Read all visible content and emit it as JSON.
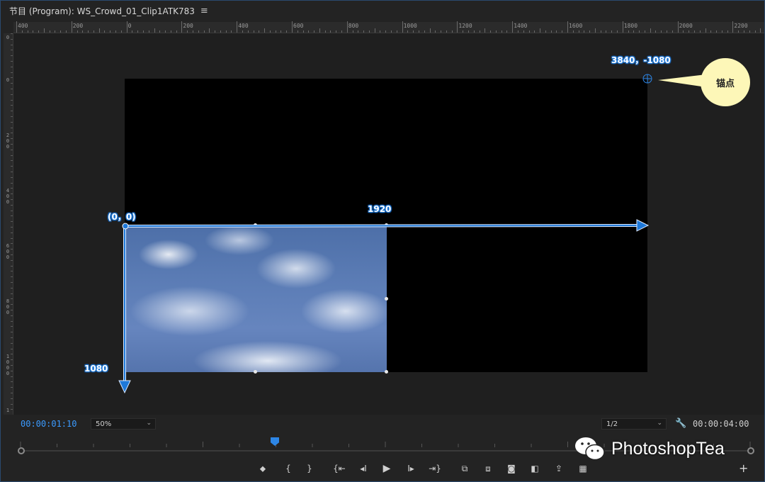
{
  "window": {
    "title": "节目 (Program): WS_Crowd_01_Clip1ATK783",
    "menu_icon": "hamburger-icon"
  },
  "ruler_h": [
    "400",
    "200",
    "0",
    "200",
    "400",
    "600",
    "800",
    "1000",
    "1200",
    "1400",
    "1600",
    "1800",
    "2000",
    "2200"
  ],
  "ruler_v": [
    "0",
    "0",
    "2\n0\n0",
    "4\n0\n0",
    "6\n0\n0",
    "8\n0\n0",
    "1\n0\n0\n0",
    "1"
  ],
  "annotations": {
    "origin": "(0，0)",
    "width_label": "1920",
    "height_label": "1080",
    "anchor_coords": "3840，-1080",
    "anchor_callout": "锚点"
  },
  "bottom_bar": {
    "current_time": "00:00:01:10",
    "zoom": "50%",
    "resolution": "1/2",
    "duration": "00:00:04:00",
    "wrench_icon": "wrench-icon"
  },
  "controls": [
    {
      "name": "add-marker-button",
      "glyph": "⬥"
    },
    {
      "name": "mark-in-button",
      "glyph": "{"
    },
    {
      "name": "mark-out-button",
      "glyph": "}"
    },
    {
      "name": "go-to-in-button",
      "glyph": "{⇤"
    },
    {
      "name": "step-back-button",
      "glyph": "◂I"
    },
    {
      "name": "play-button",
      "glyph": "▶"
    },
    {
      "name": "step-forward-button",
      "glyph": "I▸"
    },
    {
      "name": "go-to-out-button",
      "glyph": "⇥}"
    },
    {
      "name": "insert-button",
      "glyph": "⧉"
    },
    {
      "name": "overwrite-button",
      "glyph": "⧈"
    },
    {
      "name": "export-frame-button",
      "glyph": "◙"
    },
    {
      "name": "compare-button",
      "glyph": "◧"
    },
    {
      "name": "share-button",
      "glyph": "⇪"
    },
    {
      "name": "multi-camera-button",
      "glyph": "▦"
    }
  ],
  "watermark": "PhotoshopTea",
  "colors": {
    "accent": "#2d86e6",
    "timecode": "#3b9bff",
    "callout_bg": "#fdf7b8"
  }
}
